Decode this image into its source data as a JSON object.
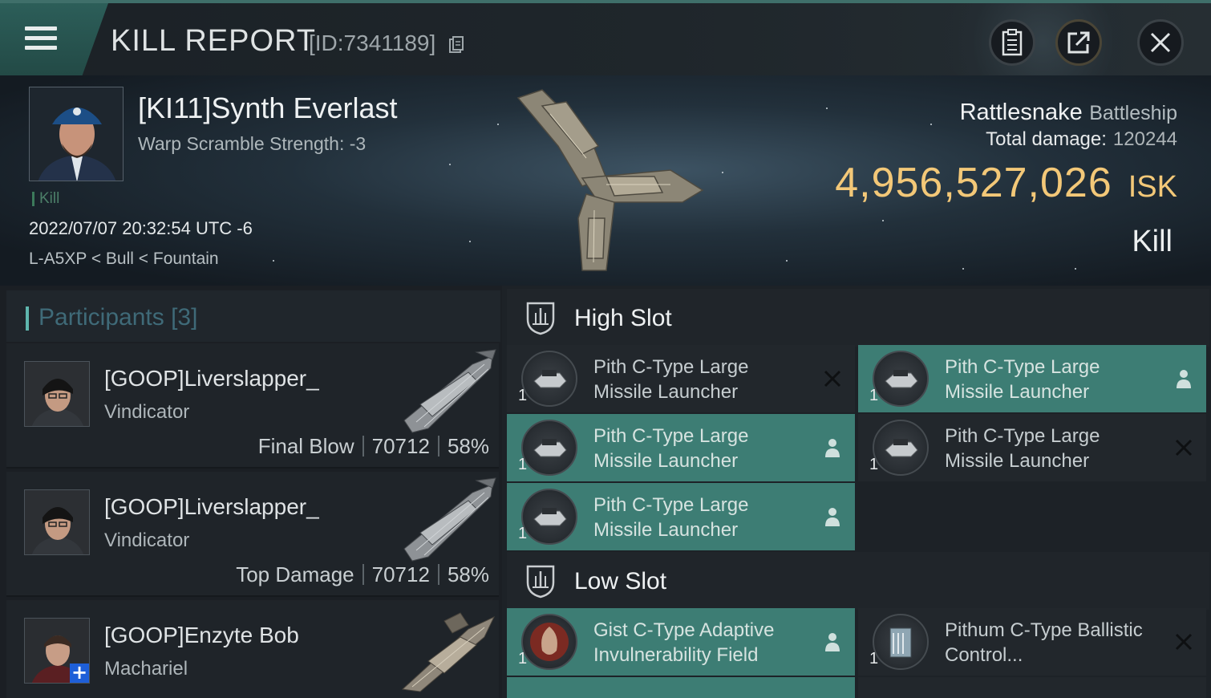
{
  "header": {
    "title": "KILL REPORT",
    "report_id": "[ID:7341189]"
  },
  "victim": {
    "name": "[KI11]Synth Everlast",
    "warp_scramble": "Warp Scramble Strength: -3",
    "kill_tag": "Kill",
    "datetime": "2022/07/07 20:32:54 UTC -6",
    "location": "L-A5XP < Bull < Fountain",
    "ship_name": "Rattlesnake",
    "ship_class": "Battleship",
    "total_damage_label": "Total damage:",
    "total_damage": "120244",
    "isk_value": "4,956,527,026",
    "isk_unit": "ISK",
    "kill_type": "Kill"
  },
  "participants": {
    "title": "Participants [3]",
    "rows": [
      {
        "name": "[GOOP]Liverslapper_",
        "ship": "Vindicator",
        "role": "Final Blow",
        "damage": "70712",
        "percent": "58%"
      },
      {
        "name": "[GOOP]Liverslapper_",
        "ship": "Vindicator",
        "role": "Top Damage",
        "damage": "70712",
        "percent": "58%"
      },
      {
        "name": "[GOOP]Enzyte Bob",
        "ship": "Machariel"
      }
    ]
  },
  "fitting": {
    "high_slot": {
      "title": "High Slot",
      "items": [
        {
          "qty": "1",
          "name": "Pith C-Type Large Missile Launcher",
          "status": "destroyed"
        },
        {
          "qty": "1",
          "name": "Pith C-Type Large Missile Launcher",
          "status": "dropped"
        },
        {
          "qty": "1",
          "name": "Pith C-Type Large Missile Launcher",
          "status": "dropped"
        },
        {
          "qty": "1",
          "name": "Pith C-Type Large Missile Launcher",
          "status": "destroyed"
        },
        {
          "qty": "1",
          "name": "Pith C-Type Large Missile Launcher",
          "status": "dropped"
        }
      ]
    },
    "low_slot": {
      "title": "Low Slot",
      "items": [
        {
          "qty": "1",
          "name": "Gist C-Type Adaptive Invulnerability Field",
          "status": "dropped"
        },
        {
          "qty": "1",
          "name": "Pithum C-Type Ballistic Control...",
          "status": "destroyed"
        }
      ]
    }
  },
  "colors": {
    "accent": "#3d7d74",
    "isk": "#f3c878",
    "kill_tag": "#3c7a5b"
  }
}
